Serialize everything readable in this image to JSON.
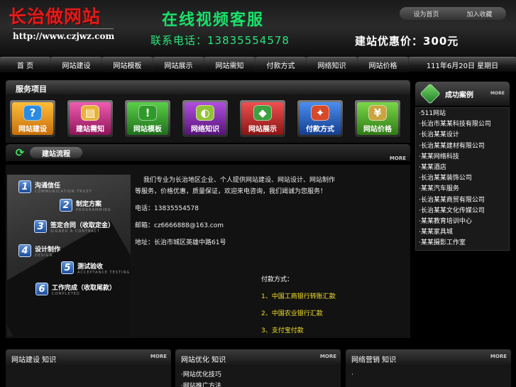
{
  "header": {
    "logo_cn": "长治做网站",
    "logo_url": "http://www.czjwz.com",
    "slogan": "在线视频客服",
    "phone": "联系电话：13835554578",
    "price": "建站优惠价：300元",
    "links": [
      "设为首页",
      "加入收藏"
    ]
  },
  "nav": {
    "items": [
      "首 页",
      "网站建设",
      "网站模板",
      "网站展示",
      "网站需知",
      "付款方式",
      "网络知识",
      "网站价格"
    ],
    "date": "111年6月20日 星期日"
  },
  "services": {
    "title": "服务项目",
    "items": [
      {
        "label": "网站建设",
        "icon": "?",
        "color": "#f0a020"
      },
      {
        "label": "建站需知",
        "icon": "▤",
        "color": "#d8348f"
      },
      {
        "label": "网站模板",
        "icon": "!",
        "color": "#3aa72f"
      },
      {
        "label": "网络知识",
        "icon": "◐",
        "color": "#8f2bb7"
      },
      {
        "label": "网站展示",
        "icon": "◆",
        "color": "#d83a3a"
      },
      {
        "label": "付款方式",
        "icon": "✦",
        "color": "#2a6bd6"
      },
      {
        "label": "网站价格",
        "icon": "¥",
        "color": "#5ab933"
      }
    ]
  },
  "process": {
    "title": "建站流程",
    "more": "MORE",
    "steps": [
      {
        "num": "1",
        "title": "沟通信任",
        "en": "COMMUNICATION TRUST"
      },
      {
        "num": "2",
        "title": "制定方案",
        "en": "PROGRAMMING"
      },
      {
        "num": "3",
        "title": "签定合同（收取定金）",
        "en": "SIGNED A CONTRACT"
      },
      {
        "num": "4",
        "title": "设计制作",
        "en": "DESIGN"
      },
      {
        "num": "5",
        "title": "测试验收",
        "en": "ACCEPTANCE TESTING"
      },
      {
        "num": "6",
        "title": "工作完成（收取尾款）",
        "en": "COMPLETED"
      }
    ]
  },
  "content": {
    "intro1": "我们专业为长治地区企业、个人提供网站建设、网站设计、网站制作",
    "intro2": "等服务，价格优惠，质量保证，欢迎来电咨询，我们竭诚为您服务！",
    "phone": "电话：13835554578",
    "email": "邮箱：cz6666888@163.com",
    "address": "地址：长治市城区英雄中路61号",
    "pay_head": "付款方式：",
    "pay_lines": [
      "1、中国工商银行转账汇款",
      "2、中国农业银行汇款",
      "3、支付宝付款"
    ]
  },
  "cases": {
    "title": "成功案例",
    "more": "MORE",
    "items": [
      "·511网站",
      "·长治市某某科技有限公司",
      "·长治某某设计",
      "·长治某某建材有限公司",
      "·某某网络科技",
      "·某某酒店",
      "·长治某某装饰公司",
      "·某某汽车服务",
      "·长治某某商贸有限公司",
      "·长治某某文化传媒公司",
      "·某某教育培训中心",
      "·某某家具城",
      "·某某摄影工作室"
    ]
  },
  "bottom": [
    {
      "title": "网站建设  知识",
      "more": "MORE",
      "items": []
    },
    {
      "title": "网站优化  知识",
      "more": "MORE",
      "items": [
        "·网站优化技巧",
        "·网站推广方法"
      ]
    },
    {
      "title": "网络营销  知识",
      "more": "MORE",
      "items": [
        "·"
      ]
    }
  ]
}
